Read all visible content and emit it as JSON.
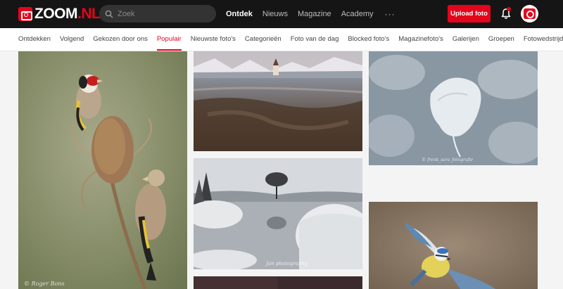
{
  "brand": {
    "name_main": "ZOOM",
    "name_suffix": ".NL"
  },
  "search": {
    "placeholder": "Zoek"
  },
  "main_nav": [
    "Ontdek",
    "Nieuws",
    "Magazine",
    "Academy"
  ],
  "main_nav_more": "···",
  "upload_label": "Upload foto",
  "sub_nav": [
    "Ontdekken",
    "Volgend",
    "Gekozen door ons",
    "Populair",
    "Nieuwste foto's",
    "Categorieën",
    "Foto van de dag",
    "Blocked foto's",
    "Magazinefoto's",
    "Galerijen",
    "Groepen",
    "Fotowedstrijden"
  ],
  "watermarks": {
    "goldfinch": "© Roger Bons",
    "snowy_lake": "Jan photography",
    "frozen_pond": "© frenk_sara_fotografie"
  },
  "icons": {
    "search": "search-icon",
    "bell": "bell-icon",
    "avatar": "camera-avatar-icon",
    "logo": "camera-logo-icon"
  },
  "colors": {
    "brand_red": "#e3051b",
    "topbar": "#151515",
    "active_tab": "#e3051b"
  }
}
